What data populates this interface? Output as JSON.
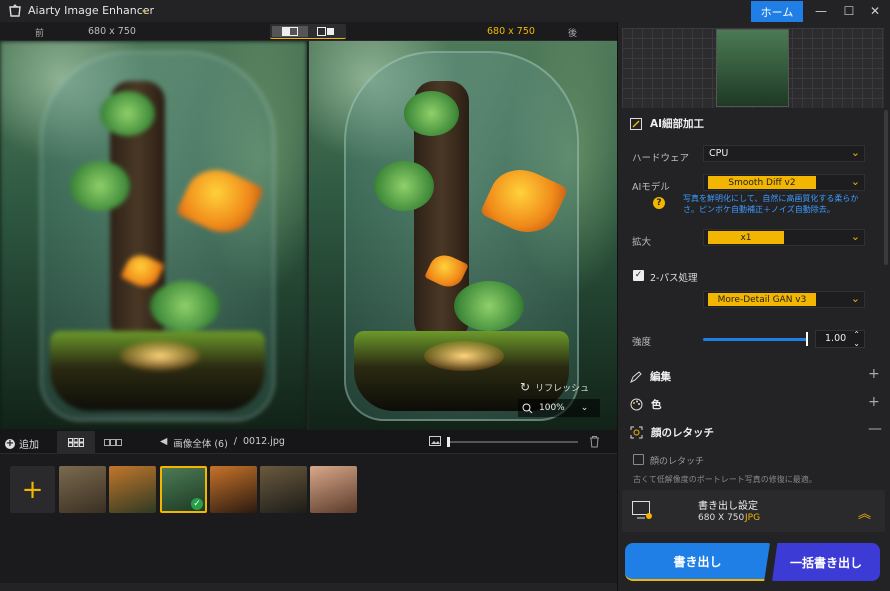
{
  "app": {
    "title": "Aiarty Image Enhancer",
    "home": "ホーム"
  },
  "compare": {
    "before_label": "前",
    "before_size": "680 x 750",
    "after_size": "680 x 750",
    "after_label": "後"
  },
  "image_overlay": {
    "refresh": "リフレッシュ",
    "zoom": "100%"
  },
  "thumb_toolbar": {
    "add": "追加",
    "path_all": "画像全体 (6)",
    "sep": "/",
    "file": "0012.jpg"
  },
  "thumbnails": [
    {
      "name": "moth",
      "colors": [
        "#7a6a4e",
        "#3a2f22"
      ]
    },
    {
      "name": "tiger",
      "colors": [
        "#c2762c",
        "#2f3a22"
      ]
    },
    {
      "name": "terrarium",
      "colors": [
        "#4c7a55",
        "#1e3a24"
      ],
      "selected": true
    },
    {
      "name": "burger",
      "colors": [
        "#c8732a",
        "#2a1a10"
      ]
    },
    {
      "name": "owl",
      "colors": [
        "#6a5a3e",
        "#1c1c18"
      ]
    },
    {
      "name": "portrait",
      "colors": [
        "#d8a88a",
        "#5a3a2a"
      ]
    }
  ],
  "panel": {
    "detail_section": "AI細部加工",
    "hardware_label": "ハードウェア",
    "hardware_value": "CPU",
    "model_label": "AIモデル",
    "model_value": "Smooth Diff  v2",
    "model_hint": "写真を鮮明化にして、自然に高画質化する柔らかさ。ピンボケ自動補正＋ノイズ自動除去。",
    "scale_label": "拡大",
    "scale_value": "x1",
    "twopass_label": "2-パス処理",
    "twopass_value": "More-Detail GAN  v3",
    "strength_label": "強度",
    "strength_value": "1.00",
    "edit_section": "編集",
    "color_section": "色",
    "face_section": "顔のレタッチ",
    "face_checkbox": "顔のレタッチ",
    "face_desc": "古くて低解像度のポートレート写真の修復に最適。"
  },
  "export": {
    "title": "書き出し設定",
    "size": "680 X 750",
    "format": "JPG",
    "export_button": "書き出し",
    "batch_button": "一括書き出し"
  }
}
